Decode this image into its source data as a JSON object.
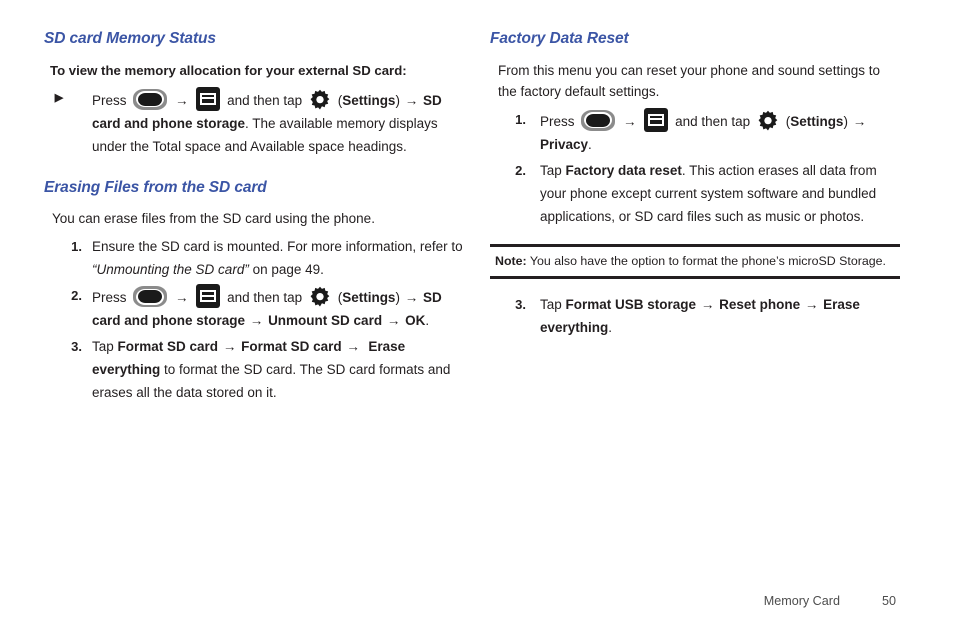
{
  "document": {
    "footer": {
      "chapter": "Memory Card",
      "page_number": "50"
    }
  },
  "left_column": {
    "section_1": {
      "heading": "SD card Memory Status",
      "lead": "To view the memory allocation for your external SD card:",
      "bullet_marker": "▶",
      "step": {
        "press_label": "Press",
        "home_icon": "home-key-icon",
        "arrow_1": "→",
        "menu_icon": "menu-key-icon",
        "and_then_tap": "and then tap",
        "gear_icon": "settings-gear-icon",
        "settings_open_paren": "(",
        "settings_label": "Settings",
        "settings_close_paren": ")",
        "arrow_2": "→",
        "target_bold": "SD card and phone storage",
        "tail": ". The available memory displays under the Total space and Available space headings."
      }
    },
    "section_2": {
      "heading": "Erasing Files from the SD card",
      "lead": "You can erase files from the SD card using the phone.",
      "steps": [
        {
          "marker": "1.",
          "text_before": "Ensure the SD card is mounted. For more information, refer to ",
          "italic_quote": "“Unmounting the SD card”",
          "text_after": " on page 49."
        },
        {
          "marker": "2.",
          "press_label": "Press",
          "arrow_1": "→",
          "and_then_tap": "and then tap",
          "settings_open_paren": "(",
          "settings_label": "Settings",
          "settings_close_paren": ")",
          "arrow_2": "→",
          "path_1": "SD card and phone storage",
          "arrow_3": "→",
          "path_2": "Unmount SD card",
          "arrow_4": "→",
          "path_3": "OK",
          "period": "."
        },
        {
          "marker": "3.",
          "tap_label": "Tap ",
          "path_1": "Format SD card",
          "arrow_1": "→",
          "path_2": "Format SD card",
          "arrow_2": "→",
          "path_3": "Erase everything",
          "tail": " to format the SD card. The SD card formats and erases all the data stored on it."
        }
      ]
    }
  },
  "right_column": {
    "section_1": {
      "heading": "Factory Data Reset",
      "lead": "From this menu you can reset your phone and sound settings to the factory default settings.",
      "steps": [
        {
          "marker": "1.",
          "press_label": "Press",
          "arrow_1": "→",
          "and_then_tap": "and then tap",
          "settings_open_paren": "(",
          "settings_label": "Settings",
          "settings_close_paren": ")",
          "arrow_2": "→",
          "path_1": "Privacy",
          "period": "."
        },
        {
          "marker": "2.",
          "tap_label": "Tap ",
          "path_1": "Factory data reset",
          "tail": ". This action erases all data from your phone except current system software and bundled applications, or SD card files such as music or photos."
        }
      ],
      "note": {
        "label": "Note:",
        "text": " You also have the option to format the phone’s microSD Storage."
      },
      "step_3": {
        "marker": "3.",
        "tap_label": "Tap ",
        "path_1": "Format USB storage",
        "arrow_1": "→",
        "path_2": "Reset phone",
        "arrow_2": "→",
        "path_3": "Erase everything",
        "period": "."
      }
    }
  },
  "colors": {
    "heading_blue": "#3b55a5",
    "body_black": "#231f20",
    "footer_gray": "#4d4d4d"
  }
}
